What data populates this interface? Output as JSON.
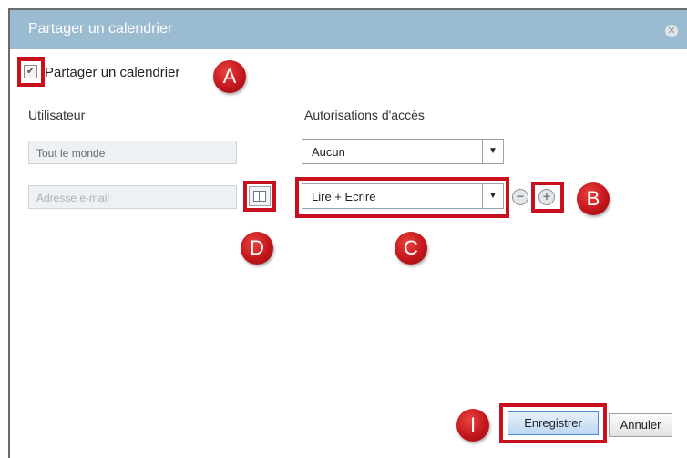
{
  "dialog": {
    "title": "Partager un calendrier",
    "close_icon": "close-icon"
  },
  "share_checkbox": {
    "label": "Partager un calendrier",
    "checked": true,
    "check_glyph": "✔"
  },
  "columns": {
    "user_header": "Utilisateur",
    "access_header": "Autorisations d'accès"
  },
  "rows": [
    {
      "user_value": "Tout le monde",
      "access_value": "Aucun"
    },
    {
      "user_placeholder": "Adresse e-mail",
      "access_value": "Lire + Ecrire"
    }
  ],
  "icons": {
    "remove": "−",
    "add": "+",
    "dropdown": "▼"
  },
  "markers": {
    "a": "A",
    "b": "B",
    "c": "C",
    "d": "D",
    "i": "I"
  },
  "buttons": {
    "save_label": "Enregistrer",
    "cancel_label": "Annuler"
  },
  "colors": {
    "titlebar": "#9bbbd1",
    "highlight": "#c8101e",
    "marker": "#c4161c"
  }
}
